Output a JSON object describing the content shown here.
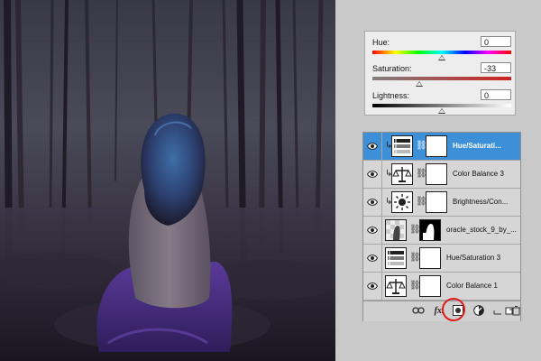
{
  "hue_saturation": {
    "hue": {
      "label": "Hue:",
      "value": "0",
      "fraction": 0.5
    },
    "saturation": {
      "label": "Saturation:",
      "value": "-33",
      "fraction": 0.335
    },
    "lightness": {
      "label": "Lightness:",
      "value": "0",
      "fraction": 0.5
    }
  },
  "layers": [
    {
      "name": "Hue/Saturati...",
      "type": "hue-saturation",
      "selected": true,
      "clipped": true
    },
    {
      "name": "Color Balance 3",
      "type": "color-balance",
      "selected": false,
      "clipped": true
    },
    {
      "name": "Brightness/Con...",
      "type": "brightness-contrast",
      "selected": false,
      "clipped": true
    },
    {
      "name": "oracle_stock_9_by_...",
      "type": "image",
      "selected": false,
      "clipped": false
    },
    {
      "name": "Hue/Saturation 3",
      "type": "hue-saturation",
      "selected": false,
      "clipped": false
    },
    {
      "name": "Color Balance 1",
      "type": "color-balance",
      "selected": false,
      "clipped": false
    }
  ],
  "footer_icons": [
    "link-icon",
    "fx-icon",
    "add-mask-icon",
    "new-adjustment-layer-icon",
    "new-group-icon",
    "new-layer-icon",
    "trash-icon"
  ],
  "footer": {
    "fx_label": "fx."
  },
  "colors": {
    "selection": "#3d8fd8",
    "highlight_circle": "#e11a1a"
  }
}
